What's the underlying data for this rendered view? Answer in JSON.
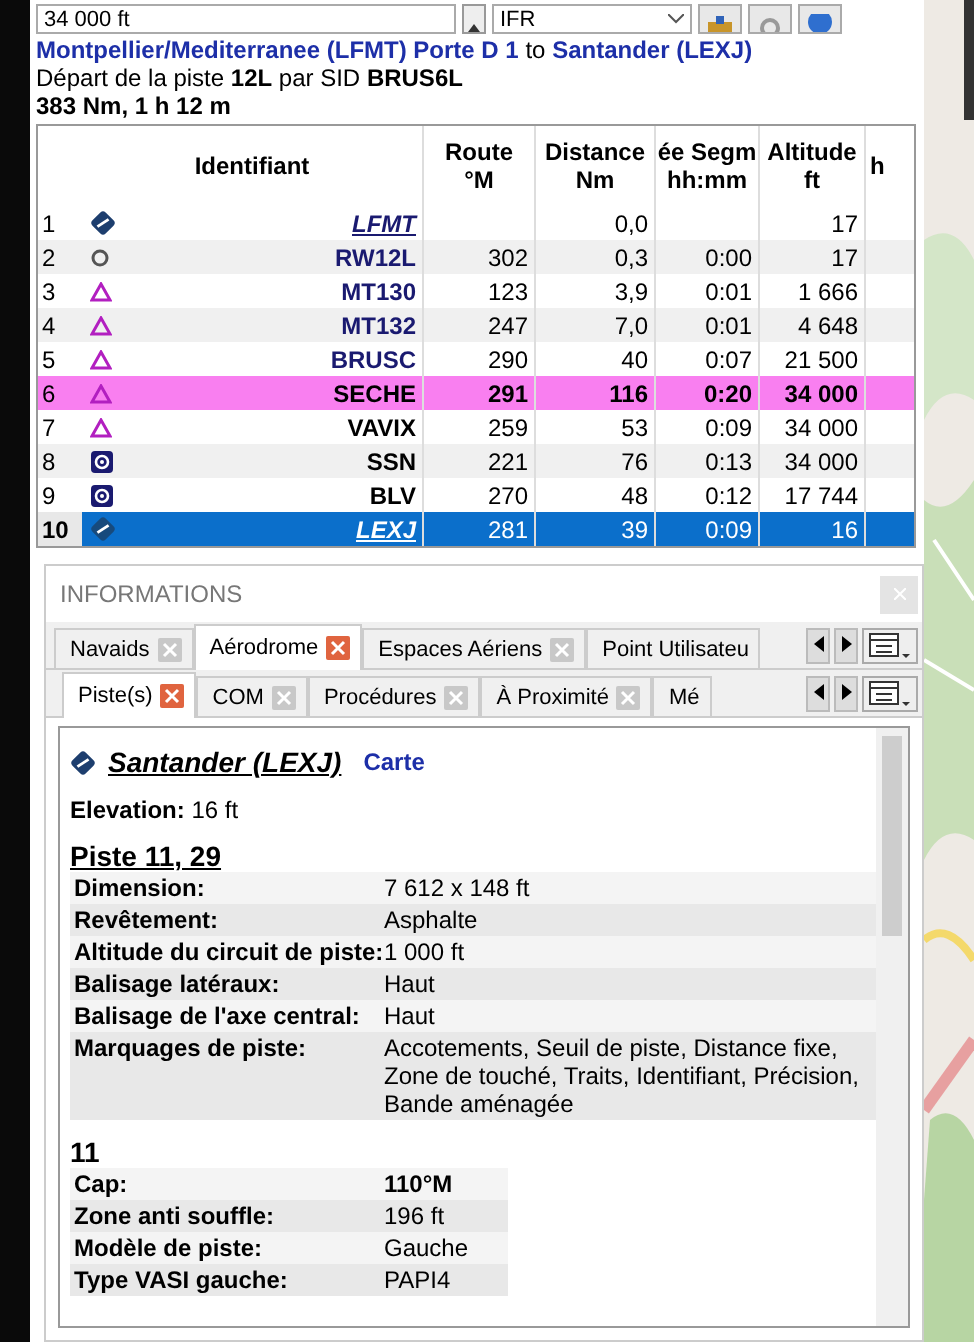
{
  "toolbar": {
    "altitude": "34 000 ft",
    "flight_rules": "IFR"
  },
  "header": {
    "from": "Montpellier/Mediterranee (LFMT) Porte D 1",
    "connector": "to",
    "to": "Santander (LEXJ)",
    "departure": "Départ de la piste **12L** par SID **BRUS6L**",
    "summary": "383 Nm, 1 h 12 m"
  },
  "table": {
    "columns": [
      {
        "line1": "Identifiant"
      },
      {
        "line1": "Route",
        "line2": "°M"
      },
      {
        "line1": "Distance",
        "line2": "Nm"
      },
      {
        "line1": "ée Segm",
        "line2": "hh:mm"
      },
      {
        "line1": "Altitude",
        "line2": "ft"
      },
      {
        "line2": "h"
      }
    ],
    "rows": [
      {
        "index": "1",
        "kind": "airport",
        "ident": "LFMT",
        "route": "",
        "distance": "0,0",
        "time": "",
        "altitude": "17",
        "active": false,
        "selected": false
      },
      {
        "index": "2",
        "kind": "runway",
        "ident": "RW12L",
        "route": "302",
        "distance": "0,3",
        "time": "0:00",
        "altitude": "17",
        "active": false,
        "selected": false
      },
      {
        "index": "3",
        "kind": "waypoint",
        "ident": "MT130",
        "route": "123",
        "distance": "3,9",
        "time": "0:01",
        "altitude": "1 666",
        "active": false,
        "selected": false
      },
      {
        "index": "4",
        "kind": "waypoint",
        "ident": "MT132",
        "route": "247",
        "distance": "7,0",
        "time": "0:01",
        "altitude": "4 648",
        "active": false,
        "selected": false
      },
      {
        "index": "5",
        "kind": "waypoint",
        "ident": "BRUSC",
        "route": "290",
        "distance": "40",
        "time": "0:07",
        "altitude": "21 500",
        "active": false,
        "selected": false
      },
      {
        "index": "6",
        "kind": "waypoint",
        "ident": "SECHE",
        "route": "291",
        "distance": "116",
        "time": "0:20",
        "altitude": "34 000",
        "active": true,
        "selected": false
      },
      {
        "index": "7",
        "kind": "waypoint",
        "ident": "VAVIX",
        "route": "259",
        "distance": "53",
        "time": "0:09",
        "altitude": "34 000",
        "active": false,
        "selected": false
      },
      {
        "index": "8",
        "kind": "vor",
        "ident": "SSN",
        "route": "221",
        "distance": "76",
        "time": "0:13",
        "altitude": "34 000",
        "active": false,
        "selected": false
      },
      {
        "index": "9",
        "kind": "vor",
        "ident": "BLV",
        "route": "270",
        "distance": "48",
        "time": "0:12",
        "altitude": "17 744",
        "active": false,
        "selected": false
      },
      {
        "index": "10",
        "kind": "airport",
        "ident": "LEXJ",
        "route": "281",
        "distance": "39",
        "time": "0:09",
        "altitude": "16",
        "active": false,
        "selected": true
      }
    ]
  },
  "informations": {
    "title": "INFORMATIONS",
    "tabs": [
      {
        "label": "Navaids",
        "selected": false,
        "closable": true
      },
      {
        "label": "Aérodrome",
        "selected": true,
        "closable": true
      },
      {
        "label": "Espaces Aériens",
        "selected": false,
        "closable": true
      },
      {
        "label": "Point Utilisateu",
        "selected": false,
        "closable": false
      }
    ],
    "subtabs": [
      {
        "label": "Piste(s)",
        "selected": true,
        "closable": true
      },
      {
        "label": "COM",
        "selected": false,
        "closable": true
      },
      {
        "label": "Procédures",
        "selected": false,
        "closable": true
      },
      {
        "label": "À Proximité",
        "selected": false,
        "closable": true
      },
      {
        "label": "Mé",
        "selected": false,
        "closable": false
      }
    ],
    "airport": {
      "name": "Santander (LEXJ)",
      "link": "Carte",
      "elevation": "**Elevation:** 16 ft"
    },
    "sections": [
      {
        "title": "Piste 11, 29",
        "underline": true,
        "wide": true,
        "rows": [
          {
            "label": "Dimension:",
            "value": "7 612 x 148 ft",
            "bold": false
          },
          {
            "label": "Revêtement:",
            "value": "Asphalte",
            "bold": false
          },
          {
            "label": "Altitude du circuit de piste:",
            "value": "1 000 ft",
            "bold": false
          },
          {
            "label": "Balisage latéraux:",
            "value": "Haut",
            "bold": false
          },
          {
            "label": "Balisage de l'axe central:",
            "value": "Haut",
            "bold": false
          },
          {
            "label": "Marquages de piste:",
            "value": "Accotements, Seuil de piste, Distance fixe, Zone de touché, Traits, Identifiant, Précision, Bande aménagée",
            "bold": false
          }
        ]
      },
      {
        "title": "11",
        "underline": false,
        "wide": false,
        "rows": [
          {
            "label": "Cap:",
            "value": "110°M",
            "bold": true
          },
          {
            "label": "Zone anti souffle:",
            "value": "196 ft",
            "bold": false
          },
          {
            "label": "Modèle de piste:",
            "value": "Gauche",
            "bold": false
          },
          {
            "label": "Type VASI gauche:",
            "value": "PAPI4",
            "bold": false
          }
        ]
      }
    ]
  }
}
